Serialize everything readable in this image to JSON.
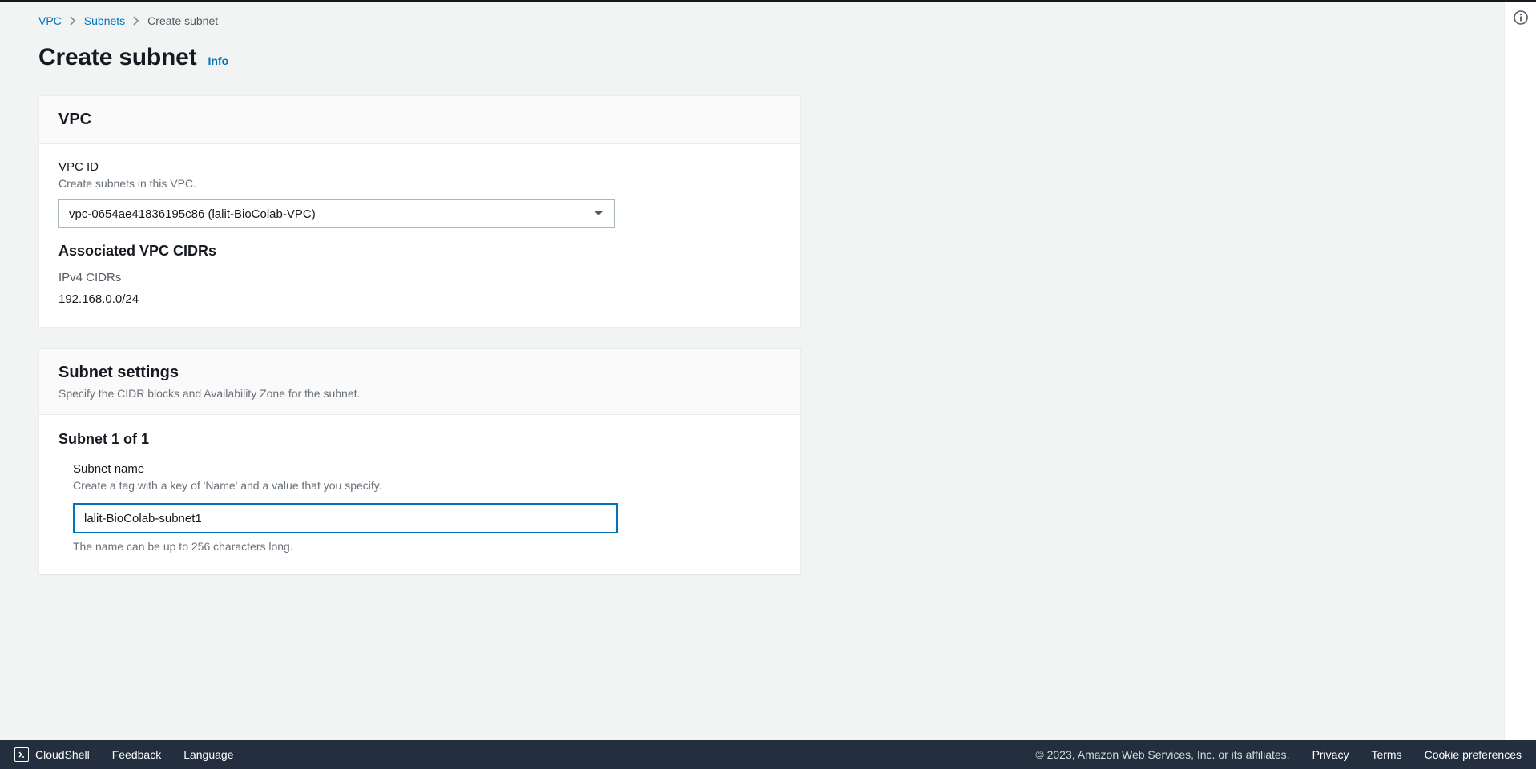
{
  "breadcrumb": {
    "items": [
      {
        "label": "VPC",
        "link": true
      },
      {
        "label": "Subnets",
        "link": true
      },
      {
        "label": "Create subnet",
        "link": false
      }
    ]
  },
  "page": {
    "title": "Create subnet",
    "info_label": "Info"
  },
  "vpc_panel": {
    "title": "VPC",
    "field_label": "VPC ID",
    "field_desc": "Create subnets in this VPC.",
    "selected_value": "vpc-0654ae41836195c86 (lalit-BioColab-VPC)",
    "assoc_title": "Associated VPC CIDRs",
    "ipv4_label": "IPv4 CIDRs",
    "ipv4_value": "192.168.0.0/24"
  },
  "subnet_panel": {
    "title": "Subnet settings",
    "subtitle": "Specify the CIDR blocks and Availability Zone for the subnet.",
    "subnet_heading": "Subnet 1 of 1",
    "name_label": "Subnet name",
    "name_desc": "Create a tag with a key of 'Name' and a value that you specify.",
    "name_value": "lalit-BioColab-subnet1",
    "name_hint": "The name can be up to 256 characters long."
  },
  "footer": {
    "cloudshell": "CloudShell",
    "feedback": "Feedback",
    "language": "Language",
    "copyright": "© 2023, Amazon Web Services, Inc. or its affiliates.",
    "privacy": "Privacy",
    "terms": "Terms",
    "cookies": "Cookie preferences"
  }
}
